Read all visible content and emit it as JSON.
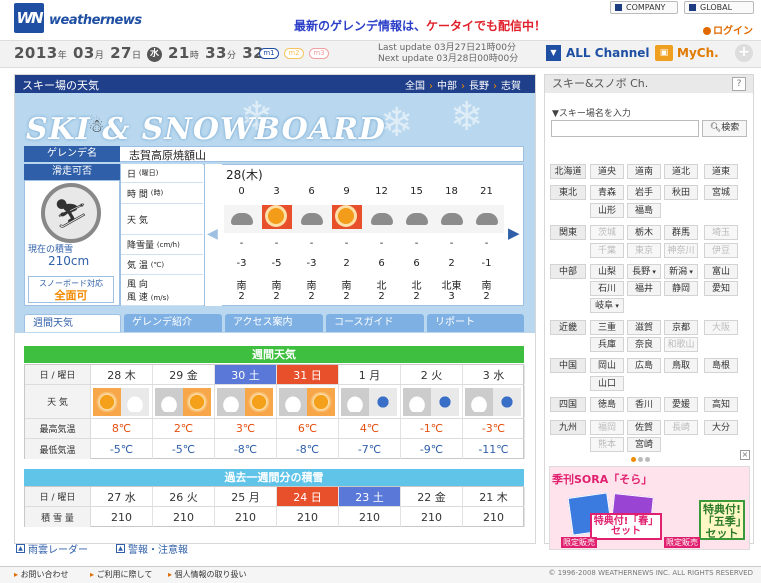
{
  "header": {
    "logo_mark": "WN",
    "logo_text": "weathernews",
    "promo_blue": "最新のゲレンデ情報は、",
    "promo_red": "ケータイでも配信中！",
    "company": "COMPANY",
    "global": "GLOBAL",
    "login": "ログイン"
  },
  "datebar": {
    "year": "2013",
    "year_unit": "年",
    "month": "03",
    "month_unit": "月",
    "day": "27",
    "day_unit": "日",
    "weekday": "水",
    "hour": "21",
    "hour_unit": "時",
    "min": "33",
    "min_unit": "分",
    "sec": "32",
    "sec_unit": "秒",
    "m1": "m1",
    "m2": "m2",
    "m3": "m3",
    "last_update": "Last update  03月27日21時00分",
    "next_update": "Next update  03月28日00時00分",
    "all_channel": "ALL Channel",
    "mych": "MyCh.",
    "plus": "+"
  },
  "ski": {
    "title": "スキー場の天気",
    "crumbs": [
      "全国",
      "中部",
      "長野",
      "志賀"
    ],
    "banner_title": "SKI & SNOWBOARD",
    "gelande_label": "ゲレンデ名",
    "gelande_name": "志賀高原焼額山",
    "status_label": "滑走可否",
    "snow_label": "現在の積雪",
    "snow_value": "210cm",
    "sb_label": "スノーボード対応",
    "sb_value": "全面可"
  },
  "hourly": {
    "labels": {
      "date": "日",
      "date_sub": "(曜日)",
      "time": "時 間",
      "time_sub": "(時)",
      "weather": "天 気",
      "snowfall": "降雪量",
      "snowfall_sub": "(cm/h)",
      "temp": "気 温",
      "temp_sub": "(℃)",
      "wind_dir": "風 向",
      "wind_speed": "風 速",
      "wind_speed_sub": "(m/s)"
    },
    "date": "28(木)",
    "hours": [
      "0",
      "3",
      "6",
      "9",
      "12",
      "15",
      "18",
      "21"
    ],
    "weather": [
      "cloud",
      "sun",
      "cloud",
      "sun",
      "cloud",
      "cloud",
      "cloud",
      "cloud"
    ],
    "snowfall": [
      "-",
      "-",
      "-",
      "-",
      "-",
      "-",
      "-",
      "-"
    ],
    "temp": [
      "-3",
      "-5",
      "-3",
      "2",
      "6",
      "6",
      "2",
      "-1"
    ],
    "wind_dir": [
      "南",
      "南",
      "南",
      "南",
      "北",
      "北",
      "北東",
      "南"
    ],
    "wind_speed": [
      "2",
      "2",
      "2",
      "2",
      "2",
      "2",
      "3",
      "2"
    ]
  },
  "tabs": [
    "週間天気",
    "ゲレンデ紹介",
    "アクセス案内",
    "コースガイド",
    "リポート"
  ],
  "weekly": {
    "title": "週間天気",
    "day_label": "日 / 曜日",
    "weather_label": "天 気",
    "hi_label": "最高気温",
    "lo_label": "最低気温",
    "days": [
      "28 木",
      "29 金",
      "30 土",
      "31 日",
      "1 月",
      "2 火",
      "3 水"
    ],
    "icons": [
      [
        "sun",
        "cloud"
      ],
      [
        "cloud",
        "sun"
      ],
      [
        "cloud",
        "sun"
      ],
      [
        "cloud",
        "sun"
      ],
      [
        "cloud",
        "snow"
      ],
      [
        "cloud",
        "snow"
      ],
      [
        "cloud",
        "snow"
      ]
    ],
    "hi": [
      "8℃",
      "2℃",
      "3℃",
      "6℃",
      "4℃",
      "-1℃",
      "-3℃"
    ],
    "lo": [
      "-5℃",
      "-5℃",
      "-8℃",
      "-8℃",
      "-7℃",
      "-9℃",
      "-11℃"
    ]
  },
  "snowhistory": {
    "title": "過去一週間分の積雪",
    "day_label": "日 / 曜日",
    "snow_label": "積 雪 量",
    "days": [
      "27 水",
      "26 火",
      "25 月",
      "24 日",
      "23 土",
      "22 金",
      "21 木"
    ],
    "values": [
      "210",
      "210",
      "210",
      "210",
      "210",
      "210",
      "210"
    ]
  },
  "footlinks": [
    "雨雲レーダー",
    "警報・注意報"
  ],
  "footer": {
    "links": [
      "お問い合わせ",
      "ご利用に際して",
      "個人情報の取り扱い"
    ],
    "copyright": "© 1996-2008 WEATHERNEWS INC. ALL RIGHTS RESERVED"
  },
  "right": {
    "title": "スキー&スノボ Ch.",
    "help": "?",
    "search_label": "▼スキー場名を入力",
    "search_btn": "検索",
    "regions": [
      [
        "北海道",
        "道央",
        "道南",
        "道北",
        "道東"
      ],
      [
        "東北",
        "青森",
        "岩手",
        "秋田",
        "宮城"
      ],
      [
        "",
        "山形",
        "福島",
        "",
        ""
      ],
      [
        "関東",
        "茨城",
        "栃木",
        "群馬",
        "埼玉"
      ],
      [
        "",
        "千葉",
        "東京",
        "神奈川",
        "伊豆"
      ],
      [
        "中部",
        "山梨",
        "長野",
        "新潟",
        "富山"
      ],
      [
        "",
        "石川",
        "福井",
        "静岡",
        "愛知"
      ],
      [
        "",
        "岐阜",
        "",
        "",
        ""
      ],
      [
        "近畿",
        "三重",
        "滋賀",
        "京都",
        "大阪"
      ],
      [
        "",
        "兵庫",
        "奈良",
        "和歌山",
        ""
      ],
      [
        "中国",
        "岡山",
        "広島",
        "鳥取",
        "島根"
      ],
      [
        "",
        "山口",
        "",
        "",
        ""
      ],
      [
        "四国",
        "徳島",
        "香川",
        "愛媛",
        "高知"
      ],
      [
        "九州",
        "福岡",
        "佐賀",
        "長崎",
        "大分"
      ],
      [
        "",
        "熊本",
        "宮崎",
        "",
        ""
      ]
    ],
    "ad_title": "季刊SORA「そら」",
    "ad_badge1": "特典付!「春」セット",
    "ad_badge2": "特典付!「五季」セット",
    "ad_limited": "限定販売"
  }
}
